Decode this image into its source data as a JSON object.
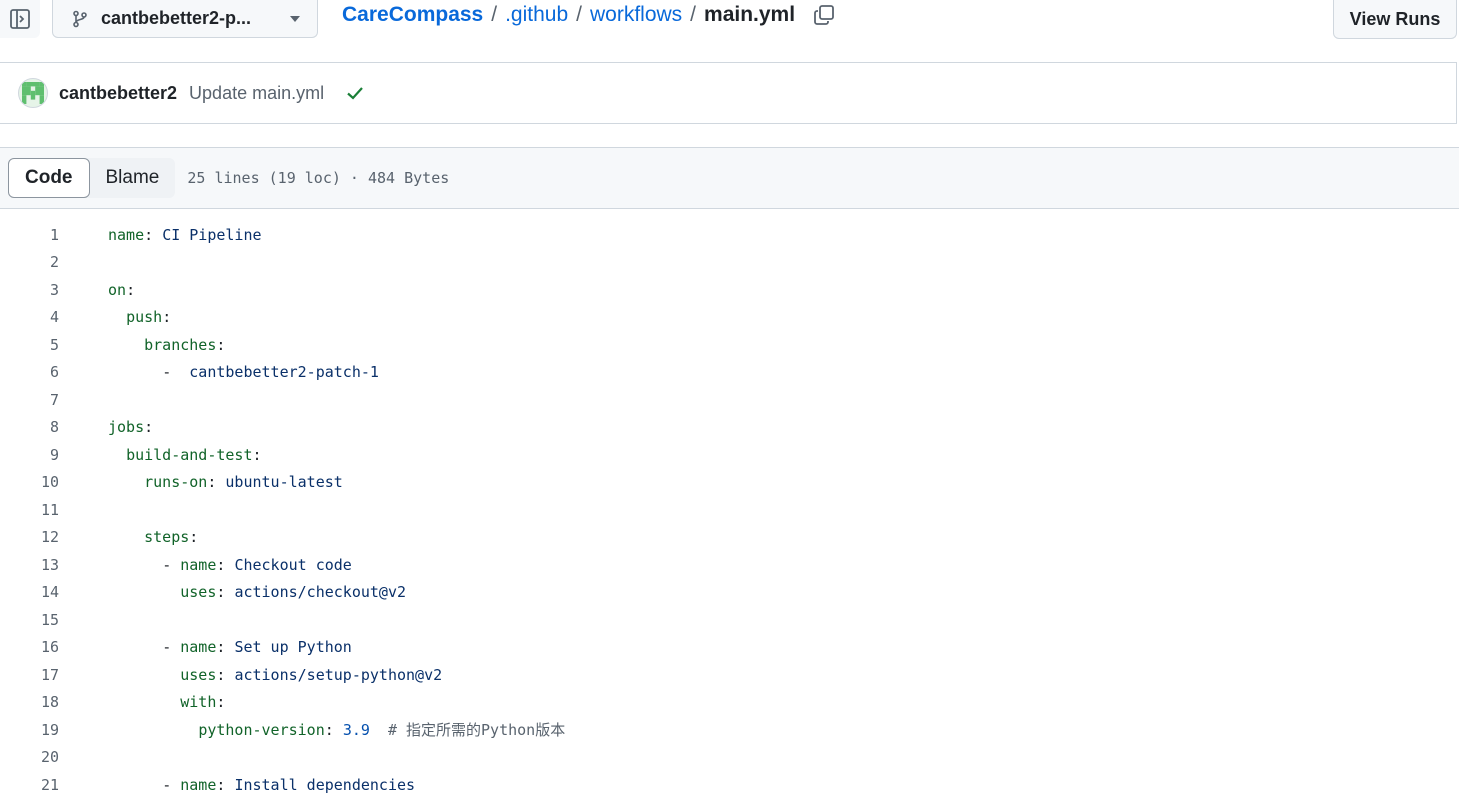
{
  "header": {
    "branch": "cantbebetter2-p...",
    "breadcrumb": [
      ".github",
      "workflows"
    ],
    "repo": "CareCompass",
    "file": "main.yml",
    "view_runs": "View Runs"
  },
  "commit": {
    "author": "cantbebetter2",
    "message": "Update main.yml",
    "status": "success"
  },
  "file_header": {
    "tabs": [
      "Code",
      "Blame"
    ],
    "active_tab": "Code",
    "info": "25 lines (19 loc) · 484 Bytes"
  },
  "code_lines": [
    {
      "n": "1",
      "indent": "",
      "key": "name",
      "val": "CI Pipeline"
    },
    {
      "n": "2",
      "indent": "",
      "key": "",
      "val": ""
    },
    {
      "n": "3",
      "indent": "",
      "key": "on",
      "val": ""
    },
    {
      "n": "4",
      "indent": "  ",
      "key": "push",
      "val": ""
    },
    {
      "n": "5",
      "indent": "    ",
      "key": "branches",
      "val": ""
    },
    {
      "n": "6",
      "indent": "      ",
      "dash": "- ",
      "val": "cantbebetter2-patch-1"
    },
    {
      "n": "7",
      "indent": "",
      "key": "",
      "val": ""
    },
    {
      "n": "8",
      "indent": "",
      "key": "jobs",
      "val": ""
    },
    {
      "n": "9",
      "indent": "  ",
      "key": "build-and-test",
      "val": ""
    },
    {
      "n": "10",
      "indent": "    ",
      "key": "runs-on",
      "val": "ubuntu-latest"
    },
    {
      "n": "11",
      "indent": "",
      "key": "",
      "val": ""
    },
    {
      "n": "12",
      "indent": "    ",
      "key": "steps",
      "val": ""
    },
    {
      "n": "13",
      "indent": "      ",
      "dash": "- ",
      "key": "name",
      "val": "Checkout code"
    },
    {
      "n": "14",
      "indent": "        ",
      "key": "uses",
      "val": "actions/checkout@v2"
    },
    {
      "n": "15",
      "indent": "",
      "key": "",
      "val": ""
    },
    {
      "n": "16",
      "indent": "      ",
      "dash": "- ",
      "key": "name",
      "val": "Set up Python"
    },
    {
      "n": "17",
      "indent": "        ",
      "key": "uses",
      "val": "actions/setup-python@v2"
    },
    {
      "n": "18",
      "indent": "        ",
      "key": "with",
      "val": ""
    },
    {
      "n": "19",
      "indent": "          ",
      "key": "python-version",
      "num": "3.9",
      "comment": "  # 指定所需的Python版本"
    },
    {
      "n": "20",
      "indent": "",
      "key": "",
      "val": ""
    },
    {
      "n": "21",
      "indent": "      ",
      "dash": "- ",
      "key": "name",
      "val": "Install dependencies"
    }
  ]
}
